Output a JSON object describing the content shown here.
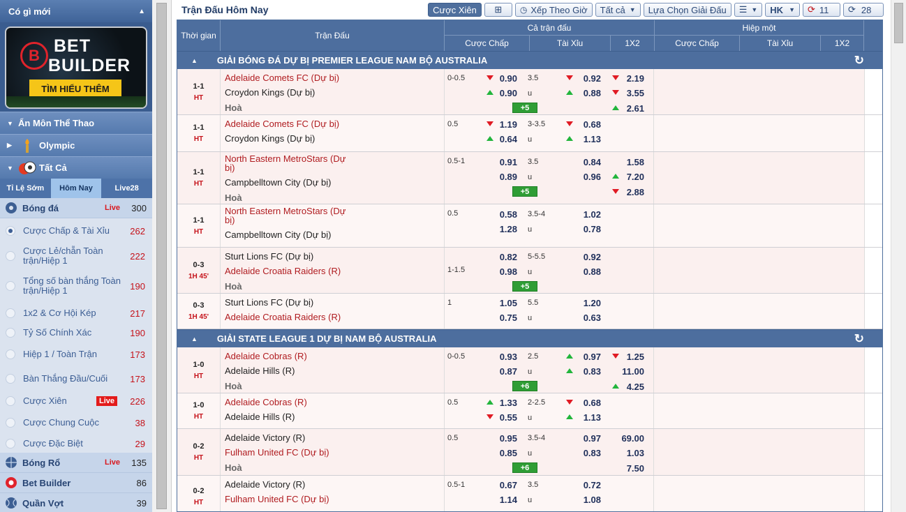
{
  "sidebar": {
    "header": "Có gì mới",
    "banner": {
      "line1": "BET",
      "line2": "BUILDER",
      "button": "TÌM HIỂU THÊM",
      "logo": "B"
    },
    "sections": [
      {
        "label": "Ẩn Môn Thể Thao",
        "icon": "chevron-down-icon"
      },
      {
        "label": "Olympic",
        "icon": "torch-icon"
      },
      {
        "label": "Tất Cả",
        "icon": "sports-balls-icon"
      }
    ],
    "tabs": [
      "Tỉ Lệ Sớm",
      "Hôm Nay",
      "Live28"
    ],
    "football": {
      "label": "Bóng đá",
      "live": "Live",
      "count": "300"
    },
    "sub_items": [
      {
        "label": "Cược Chấp & Tài Xỉu",
        "count": "262",
        "selected": true
      },
      {
        "label": "Cược Lẻ/chẵn Toàn trận/Hiệp 1",
        "count": "222"
      },
      {
        "label": "Tổng số bàn thắng Toàn trận/Hiệp 1",
        "count": "190"
      },
      {
        "label": "1x2 & Cơ Hội Kép",
        "count": "217"
      },
      {
        "label": "Tỷ Số Chính Xác",
        "count": "190"
      },
      {
        "label": "Hiệp 1 / Toàn Trận",
        "count": "173"
      },
      {
        "label": "Bàn Thắng Đầu/Cuối",
        "count": "173"
      },
      {
        "label": "Cược Xiên",
        "count": "226",
        "badge": "Live"
      },
      {
        "label": "Cược Chung Cuộc",
        "count": "38"
      },
      {
        "label": "Cược Đặc Biệt",
        "count": "29"
      }
    ],
    "sports": [
      {
        "label": "Bóng Rổ",
        "live": "Live",
        "count": "135"
      },
      {
        "label": "Bet Builder",
        "count": "86"
      },
      {
        "label": "Quần Vợt",
        "count": "39"
      }
    ]
  },
  "topbar": {
    "title": "Trận Đấu Hôm Nay",
    "parlay_label": "Cược Xiên",
    "sort_label": "Xếp Theo Giờ",
    "filter_label": "Tất cả",
    "league_select_label": "Lựa Chọn Giải Đấu",
    "odds_type": "HK",
    "refresh_count": "11",
    "refresh2_count": "28"
  },
  "headers": {
    "time": "Thời gian",
    "match": "Trận Đấu",
    "full": "Cả trận đấu",
    "half": "Hiệp một",
    "hdp": "Cược Chấp",
    "ou": "Tài Xỉu",
    "x12": "1X2"
  },
  "leagues": [
    {
      "name": "GIẢI BÓNG ĐÁ DỰ BỊ PREMIER LEAGUE NAM BỘ AUSTRALIA"
    },
    {
      "name": "GIẢI STATE LEAGUE 1 DỰ BỊ NAM BỘ AUSTRALIA"
    }
  ],
  "matches": [
    {
      "score": "1-1",
      "status": "HT",
      "home": "Adelaide Comets FC (Dự bị)",
      "away": "Croydon Kings (Dự bị)",
      "draw": "Hoà",
      "hdp_line": "0-0.5",
      "hdp_home": "0.90",
      "hdp_away": "0.90",
      "ou_line": "3.5",
      "ou_u": "u",
      "ou_over": "0.92",
      "ou_under": "0.88",
      "x1": "2.19",
      "x2": "3.55",
      "xd": "2.61",
      "more": "+5"
    },
    {
      "score": "1-1",
      "status": "HT",
      "home": "Adelaide Comets FC (Dự bị)",
      "away": "Croydon Kings (Dự bị)",
      "hdp_line": "0.5",
      "hdp_home": "1.19",
      "hdp_away": "0.64",
      "ou_line": "3-3.5",
      "ou_u": "u",
      "ou_over": "0.68",
      "ou_under": "1.13"
    },
    {
      "score": "1-1",
      "status": "HT",
      "home": "North Eastern MetroStars (Dự bị)",
      "away": "Campbelltown City (Dự bị)",
      "draw": "Hoà",
      "hdp_line": "0.5-1",
      "hdp_home": "0.91",
      "hdp_away": "0.89",
      "ou_line": "3.5",
      "ou_u": "u",
      "ou_over": "0.84",
      "ou_under": "0.96",
      "x1": "1.58",
      "x2": "7.20",
      "xd": "2.88",
      "more": "+5"
    },
    {
      "score": "1-1",
      "status": "HT",
      "home": "North Eastern MetroStars (Dự bị)",
      "away": "Campbelltown City (Dự bị)",
      "hdp_line": "0.5",
      "hdp_home": "0.58",
      "hdp_away": "1.28",
      "ou_line": "3.5-4",
      "ou_u": "u",
      "ou_over": "1.02",
      "ou_under": "0.78"
    },
    {
      "score": "0-3",
      "status": "1H 45'",
      "home": "Sturt Lions FC (Dự bị)",
      "away": "Adelaide Croatia Raiders (R)",
      "draw": "Hoà",
      "hdp_line": "1-1.5",
      "hdp_home": "0.82",
      "hdp_away": "0.98",
      "ou_line": "5-5.5",
      "ou_u": "u",
      "ou_over": "0.92",
      "ou_under": "0.88",
      "more": "+5"
    },
    {
      "score": "0-3",
      "status": "1H 45'",
      "home": "Sturt Lions FC (Dự bị)",
      "away": "Adelaide Croatia Raiders (R)",
      "hdp_line": "1",
      "hdp_home": "1.05",
      "hdp_away": "0.75",
      "ou_line": "5.5",
      "ou_u": "u",
      "ou_over": "1.20",
      "ou_under": "0.63"
    },
    {
      "score": "1-0",
      "status": "HT",
      "home": "Adelaide Cobras (R)",
      "away": "Adelaide Hills (R)",
      "draw": "Hoà",
      "hdp_line": "0-0.5",
      "hdp_home": "0.93",
      "hdp_away": "0.87",
      "ou_line": "2.5",
      "ou_u": "u",
      "ou_over": "0.97",
      "ou_under": "0.83",
      "x1": "1.25",
      "x2": "11.00",
      "xd": "4.25",
      "more": "+6"
    },
    {
      "score": "1-0",
      "status": "HT",
      "home": "Adelaide Cobras (R)",
      "away": "Adelaide Hills (R)",
      "hdp_line": "0.5",
      "hdp_home": "1.33",
      "hdp_away": "0.55",
      "ou_line": "2-2.5",
      "ou_u": "u",
      "ou_over": "0.68",
      "ou_under": "1.13"
    },
    {
      "score": "0-2",
      "status": "HT",
      "home": "Adelaide Victory (R)",
      "away": "Fulham United FC (Dự bị)",
      "draw": "Hoà",
      "hdp_line": "0.5",
      "hdp_home": "0.95",
      "hdp_away": "0.85",
      "ou_line": "3.5-4",
      "ou_u": "u",
      "ou_over": "0.97",
      "ou_under": "0.83",
      "x1": "69.00",
      "x2": "1.03",
      "xd": "7.50",
      "more": "+6"
    },
    {
      "score": "0-2",
      "status": "HT",
      "home": "Adelaide Victory (R)",
      "away": "Fulham United FC (Dự bị)",
      "hdp_line": "0.5-1",
      "hdp_home": "0.67",
      "hdp_away": "1.14",
      "ou_line": "3.5",
      "ou_u": "u",
      "ou_over": "0.72",
      "ou_under": "1.08"
    }
  ]
}
